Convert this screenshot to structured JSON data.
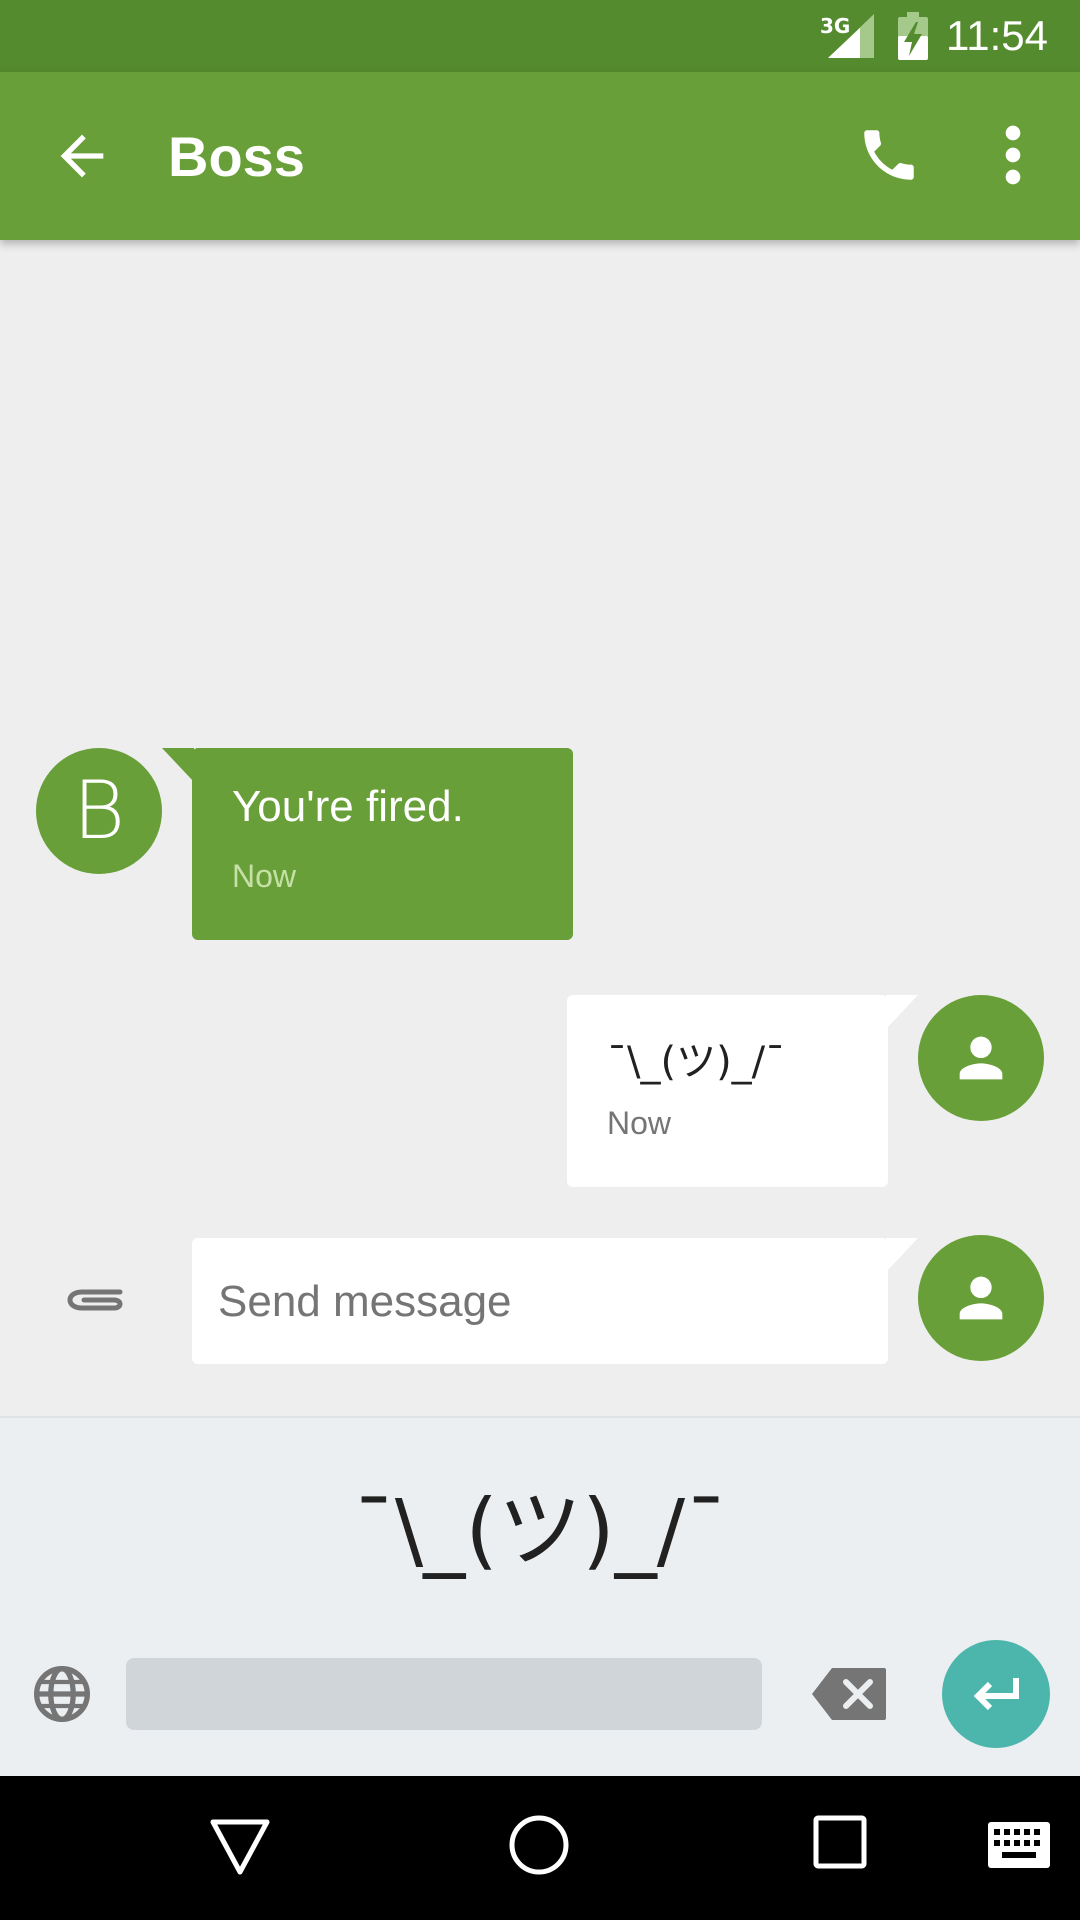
{
  "status_bar": {
    "network": "3G",
    "time": "11:54"
  },
  "app_bar": {
    "title": "Boss",
    "back_icon": "arrow-back-icon",
    "call_icon": "phone-icon",
    "menu_icon": "more-vert-icon"
  },
  "conversation": {
    "messages": [
      {
        "direction": "incoming",
        "avatar_letter": "B",
        "text": "You're fired.",
        "time": "Now",
        "bubble_color": "#689f38",
        "text_color": "#ffffff",
        "time_color": "#c5e1a5"
      },
      {
        "direction": "outgoing",
        "avatar_icon": "person-icon",
        "text": "¯\\_(ツ)_/¯",
        "time": "Now",
        "bubble_color": "#ffffff",
        "text_color": "#212121",
        "time_color": "#757575"
      }
    ]
  },
  "compose": {
    "placeholder": "Send message",
    "attach_icon": "paperclip-icon",
    "avatar_icon": "person-icon"
  },
  "keyboard": {
    "suggestion": "¯\\_(ツ)_/¯",
    "globe_icon": "globe-icon",
    "delete_icon": "backspace-icon",
    "enter_icon": "enter-icon"
  },
  "nav_bar": {
    "back_icon": "nav-back-icon",
    "home_icon": "nav-home-icon",
    "recents_icon": "nav-recents-icon",
    "keyboard_icon": "keyboard-icon"
  },
  "colors": {
    "status_bar": "#558b2f",
    "primary": "#689f38",
    "background": "#eeeeee",
    "accent": "#4db6ac"
  }
}
